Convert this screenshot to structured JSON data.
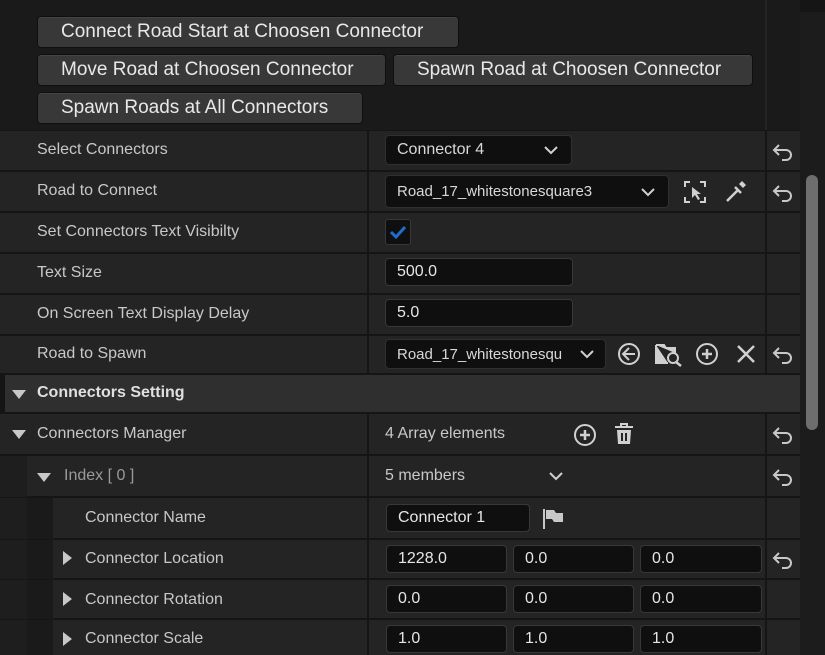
{
  "buttons": {
    "connect_start": "Connect Road Start at Choosen Connector",
    "move_road": "Move Road at Choosen Connector",
    "spawn_road": "Spawn Road at Choosen Connector",
    "spawn_all": "Spawn Roads at All Connectors"
  },
  "properties": {
    "select_connectors": {
      "label": "Select Connectors",
      "value": "Connector 4"
    },
    "road_to_connect": {
      "label": "Road to Connect",
      "value": "Road_17_whitestonesquare3"
    },
    "text_visibility": {
      "label": "Set Connectors Text Visibilty",
      "checked": true
    },
    "text_size": {
      "label": "Text Size",
      "value": "500.0"
    },
    "display_delay": {
      "label": "On Screen Text Display Delay",
      "value": "5.0"
    },
    "road_to_spawn": {
      "label": "Road to Spawn",
      "value": "Road_17_whitestonesqu"
    }
  },
  "connectors_setting": {
    "title": "Connectors Setting"
  },
  "connectors_manager": {
    "label": "Connectors Manager",
    "summary": "4 Array elements",
    "index": {
      "label": "Index",
      "bracket": "[ 0 ]",
      "summary": "5 members"
    },
    "connector_name": {
      "label": "Connector Name",
      "value": "Connector 1"
    },
    "connector_location": {
      "label": "Connector Location",
      "x": "1228.0",
      "y": "0.0",
      "z": "0.0"
    },
    "connector_rotation": {
      "label": "Connector Rotation",
      "x": "0.0",
      "y": "0.0",
      "z": "0.0"
    },
    "connector_scale": {
      "label": "Connector Scale",
      "x": "1.0",
      "y": "1.0",
      "z": "1.0"
    }
  },
  "colors": {
    "accent": "#1f6fd0",
    "panel": "#242424",
    "header": "#2f2f2f"
  },
  "icons": [
    "reset-arrow-icon",
    "chevron-down-icon",
    "pick-actor-icon",
    "eyedropper-icon",
    "use-selected-icon",
    "browse-icon",
    "add-icon",
    "clear-icon",
    "delete-icon",
    "flag-icon",
    "expand-triangle-icon"
  ]
}
